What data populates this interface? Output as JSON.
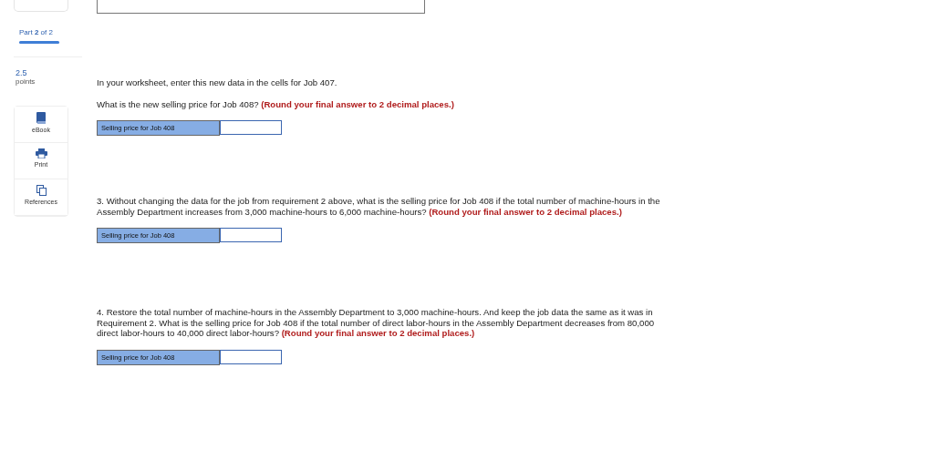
{
  "sidebar": {
    "part": "Part **2** of 2",
    "progress": {
      "level": 1
    },
    "points_value": "2.5",
    "points_label": "points",
    "tools": [
      {
        "kind": "book",
        "label": "eBook"
      },
      {
        "kind": "printer",
        "label": "Print"
      },
      {
        "kind": "copy",
        "label": "References"
      }
    ]
  },
  "questions": [
    {
      "paragraphs": [
        "In your worksheet, enter this new data in the cells for Job 407.",
        "What is the new selling price for Job 408? **(Round your final answer to 2 decimal places.)**"
      ],
      "answer_label": "Selling price for Job 408"
    },
    {
      "paragraphs": [
        "3. Without changing the data for the job from requirement 2 above, what is the selling price for Job 408 if the total number of machine-hours in the Assembly Department increases from 3,000 machine-hours to 6,000 machine-hours? **(Round your final answer to 2 decimal places.)**"
      ],
      "answer_label": "Selling price for Job 408"
    },
    {
      "paragraphs": [
        "4. Restore the total number of machine-hours in the Assembly Department to 3,000 machine-hours. And keep the job data the same as it was in Requirement 2. What is the selling price for Job 408 if the total number of direct labor-hours in the Assembly Department decreases from 80,000 direct labor-hours to 40,000 direct labor-hours? **(Round your final answer to 2 decimal places.)**"
      ],
      "answer_label": "Selling price for Job 408"
    }
  ]
}
